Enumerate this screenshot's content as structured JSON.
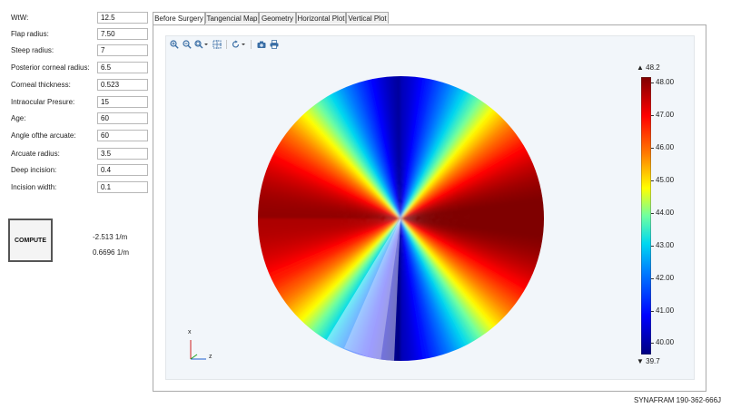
{
  "params": [
    {
      "label": "WtW:",
      "value": "12.5"
    },
    {
      "label": "Flap radius:",
      "value": "7.50"
    },
    {
      "label": "Steep radius:",
      "value": "7"
    },
    {
      "label": "Posterior corneal radius:",
      "value": "6.5"
    },
    {
      "label": "Corneal thickness:",
      "value": "0.523"
    },
    {
      "label": "Intraocular Presure:",
      "value": "15"
    },
    {
      "label": "Age:",
      "value": "60"
    },
    {
      "label": "Angle ofthe arcuate:",
      "value": "60"
    },
    {
      "label": "Arcuate radius:",
      "value": "3.5"
    },
    {
      "label": "Deep incision:",
      "value": "0.4"
    },
    {
      "label": "Incision width:",
      "value": "0.1"
    }
  ],
  "compute_label": "COMPUTE",
  "results": [
    "-2.513 1/m",
    "0.6696 1/m"
  ],
  "tabs": [
    "Before Surgery",
    "Tangencial Map",
    "Geometry",
    "Horizontal Plot",
    "Vertical Plot"
  ],
  "active_tab": 0,
  "toolbar_icons": [
    "zoom-in-icon",
    "zoom-out-icon",
    "zoom-box-icon",
    "zoom-extents-icon",
    "rotate-icon",
    "camera-icon",
    "print-icon"
  ],
  "colorbar": {
    "max_label": "▲ 48.2",
    "min_label": "▼ 39.7",
    "ticks": [
      "48.00",
      "47.00",
      "46.00",
      "45.00",
      "44.00",
      "43.00",
      "42.00",
      "41.00",
      "40.00"
    ]
  },
  "chart_data": {
    "type": "heatmap",
    "range": [
      39.7,
      48.2
    ],
    "ticks": [
      48,
      47,
      46,
      45,
      44,
      43,
      42,
      41,
      40
    ],
    "colormap": [
      "#00007f",
      "#0000ff",
      "#00bfff",
      "#3ff2c9",
      "#ffff00",
      "#ff7f00",
      "#ff0000",
      "#7f0000"
    ]
  },
  "axes": {
    "x": "x",
    "z": "z"
  },
  "footer": "SYNAFRAM  190-362-666J"
}
